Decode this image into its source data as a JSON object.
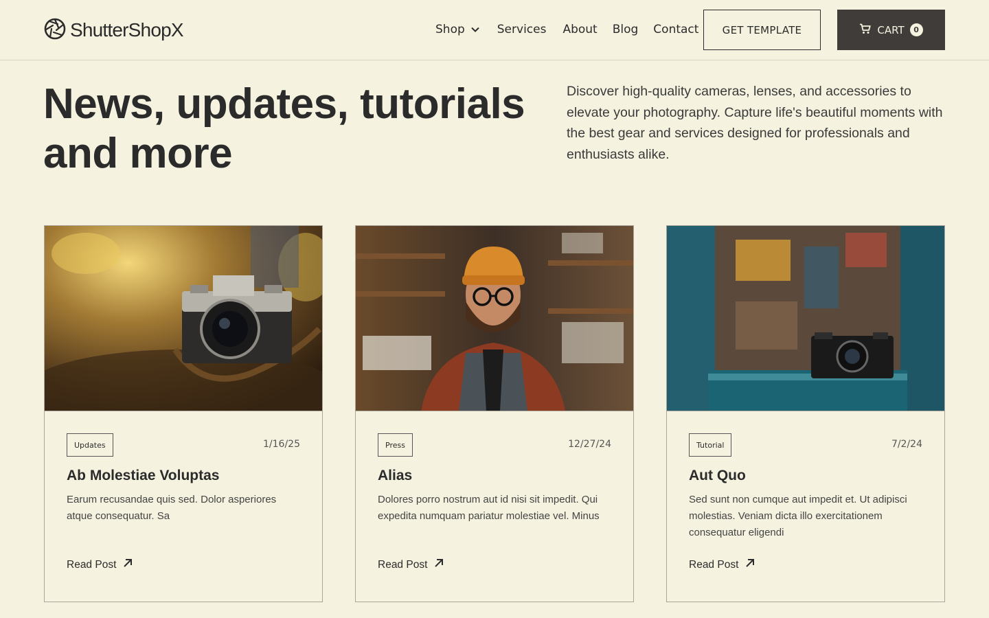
{
  "header": {
    "logo_text": "ShutterShopX",
    "nav": {
      "shop": "Shop",
      "services": "Services",
      "about": "About",
      "blog": "Blog",
      "contact": "Contact"
    },
    "get_template_label": "GET TEMPLATE",
    "cart_label": "CART",
    "cart_count": "0"
  },
  "hero": {
    "title": "News, updates, tutorials and more",
    "description": "Discover high-quality cameras, lenses, and accessories to elevate your photography. Capture life's beautiful moments with the best gear and services designed for professionals and enthusiasts alike."
  },
  "posts": [
    {
      "tag": "Updates",
      "date": "1/16/25",
      "title": "Ab Molestiae Voluptas",
      "excerpt": "Earum recusandae quis sed. Dolor asperiores atque consequatur. Sa",
      "read_label": "Read Post",
      "image_subject": "vintage-camera-on-forest-path"
    },
    {
      "tag": "Press",
      "date": "12/27/24",
      "title": "Alias",
      "excerpt": "Dolores porro nostrum aut id nisi sit impedit. Qui expedita numquam pariatur molestiae vel. Minus",
      "read_label": "Read Post",
      "image_subject": "man-in-beanie-in-camera-shop"
    },
    {
      "tag": "Tutorial",
      "date": "7/2/24",
      "title": "Aut Quo",
      "excerpt": "Sed sunt non cumque aut impedit et. Ut adipisci molestias. Veniam dicta illo exercitationem consequatur eligendi",
      "read_label": "Read Post",
      "image_subject": "camera-in-blue-window"
    }
  ],
  "colors": {
    "background": "#f5f2df",
    "text": "#2b2b2b",
    "cart_button": "#3f3c39"
  }
}
